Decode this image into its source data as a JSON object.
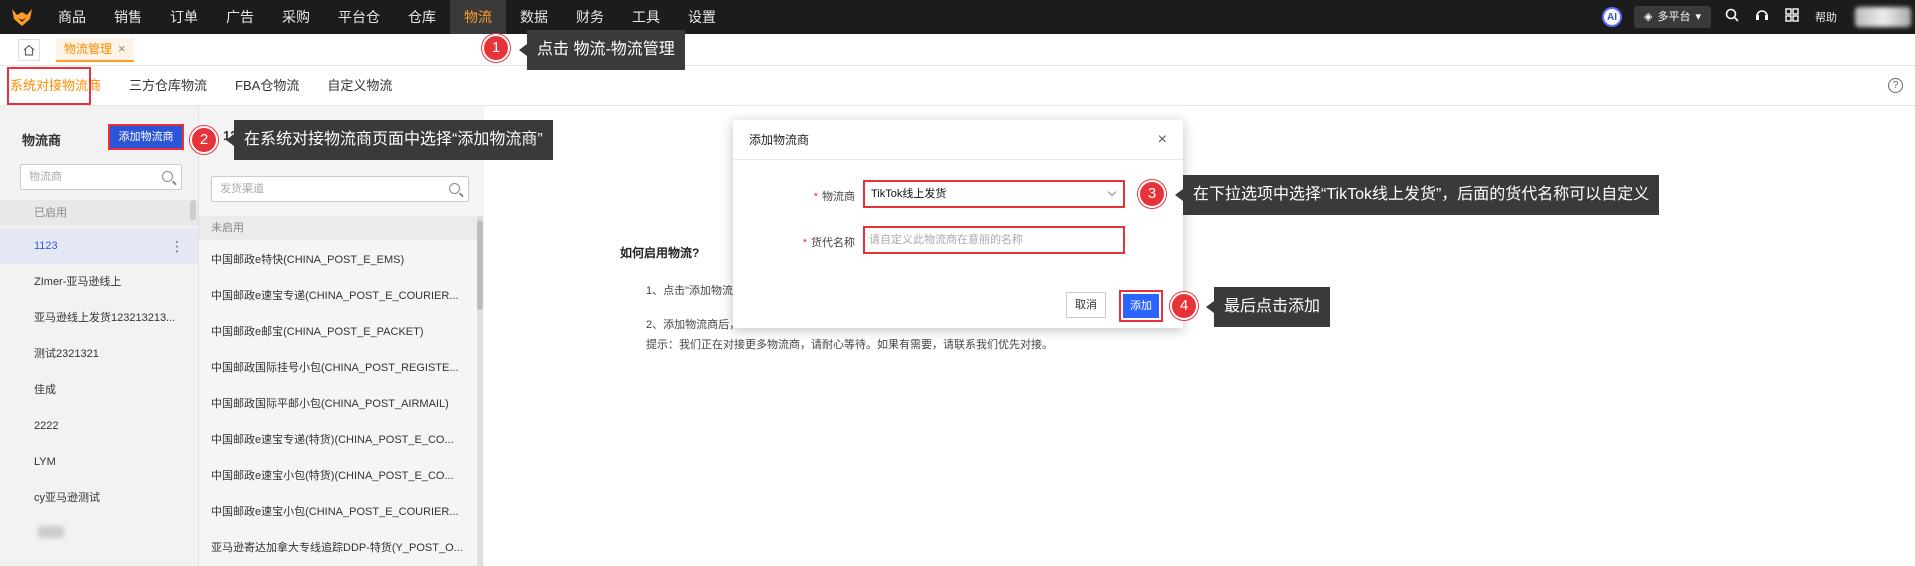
{
  "nav": {
    "items": [
      "商品",
      "销售",
      "订单",
      "广告",
      "采购",
      "平台仓",
      "仓库",
      "物流",
      "数据",
      "财务",
      "工具",
      "设置"
    ],
    "active_index": 7,
    "ai_label": "AI",
    "platform": "多平台",
    "help": "帮助"
  },
  "tabbar": {
    "page_tab": "物流管理",
    "close": "×"
  },
  "subtabs": [
    "系统对接物流商",
    "三方仓库物流",
    "FBA仓物流",
    "自定义物流"
  ],
  "carriers": {
    "title": "物流商",
    "add_button": "添加物流商",
    "search_placeholder": "物流商",
    "section_enabled": "已启用",
    "items": [
      "1123",
      "ZImer-亚马逊线上",
      "亚马逊线上发货123213213...",
      "测试2321321",
      "佳成",
      "2222",
      "LYM",
      "cy亚马逊测试"
    ],
    "selected_index": 0
  },
  "channels": {
    "header": "12",
    "search_placeholder": "发货渠道",
    "section_disabled": "未启用",
    "items": [
      "中国邮政e特快(CHINA_POST_E_EMS)",
      "中国邮政e速宝专递(CHINA_POST_E_COURIER...",
      "中国邮政e邮宝(CHINA_POST_E_PACKET)",
      "中国邮政国际挂号小包(CHINA_POST_REGISTE...",
      "中国邮政国际平邮小包(CHINA_POST_AIRMAIL)",
      "中国邮政e速宝专递(特货)(CHINA_POST_E_CO...",
      "中国邮政e速宝小包(特货)(CHINA_POST_E_CO...",
      "中国邮政e速宝小包(CHINA_POST_E_COURIER...",
      "亚马逊寄达加拿大专线追踪DDP-特货(Y_POST_O..."
    ]
  },
  "info": {
    "title": "如何启用物流?",
    "step1": "1、点击\"添加物流",
    "step2": "2、添加物流商后，",
    "tip": "提示：我们正在对接更多物流商，请耐心等待。如果有需要，请联系我们优先对接。"
  },
  "modal": {
    "title": "添加物流商",
    "close": "×",
    "carrier_label": "物流商",
    "carrier_value": "TikTok线上发货",
    "name_label": "货代名称",
    "name_placeholder": "请自定义此物流商在意丽的名称",
    "required_mark": "*",
    "cancel": "取消",
    "confirm": "添加"
  },
  "annotations": [
    {
      "num": "1",
      "text": "点击 物流-物流管理"
    },
    {
      "num": "2",
      "text": "在系统对接物流商页面中选择“添加物流商”"
    },
    {
      "num": "3",
      "text": "在下拉选项中选择“TikTok线上发货”，后面的货代名称可以自定义"
    },
    {
      "num": "4",
      "text": "最后点击添加"
    }
  ],
  "colors": {
    "accent": "#ff9c2a",
    "primary": "#2b64ff",
    "highlight": "#e8323a",
    "nav_bg": "#1c1c1c"
  }
}
